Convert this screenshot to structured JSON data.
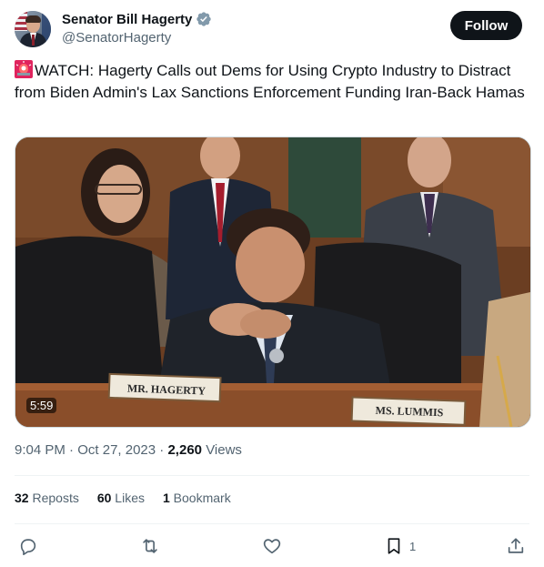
{
  "author": {
    "display_name": "Senator Bill Hagerty",
    "handle": "@SenatorHagerty",
    "verified_icon": "verified-badge-icon"
  },
  "follow_label": "Follow",
  "tweet": {
    "emoji": "siren-emoji",
    "text": "WATCH: Hagerty Calls out Dems for Using Crypto Industry to Distract from Biden Admin's Lax Sanctions Enforcement Funding Iran-Back Hamas"
  },
  "media": {
    "duration": "5:59",
    "nameplate_left": "MR. HAGERTY",
    "nameplate_right": "MS. LUMMIS"
  },
  "meta": {
    "time": "9:04 PM",
    "date": "Oct 27, 2023",
    "views_count": "2,260",
    "views_label": "Views"
  },
  "stats": {
    "reposts_count": "32",
    "reposts_label": "Reposts",
    "likes_count": "60",
    "likes_label": "Likes",
    "bookmarks_count": "1",
    "bookmarks_label": "Bookmark"
  },
  "actions": {
    "bookmark_count": "1"
  },
  "colors": {
    "text": "#0f1419",
    "muted": "#536471",
    "verified": "#829aab",
    "follow_bg": "#0f1419"
  }
}
